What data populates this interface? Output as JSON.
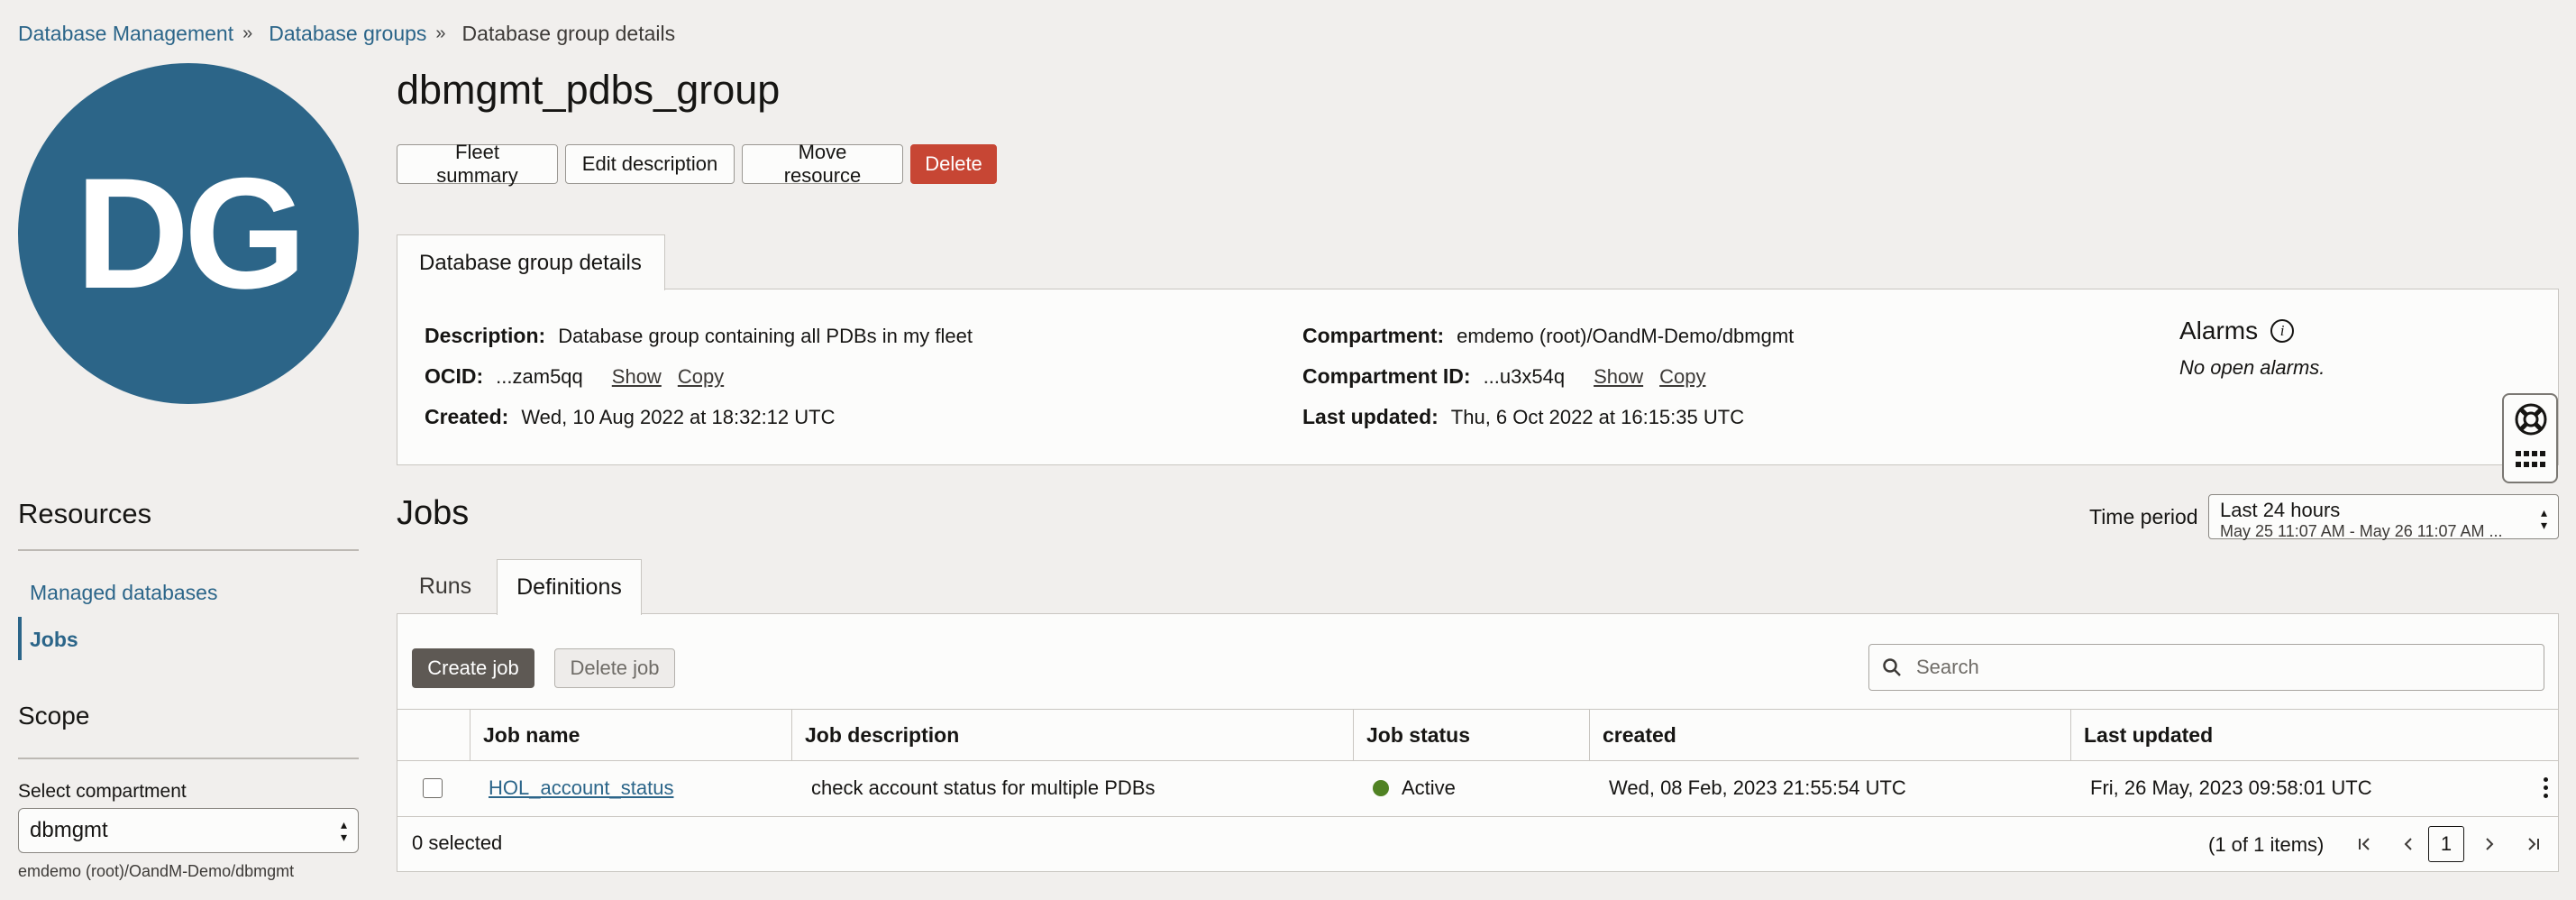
{
  "breadcrumb": {
    "items": [
      "Database Management",
      "Database groups"
    ],
    "current": "Database group details"
  },
  "avatar": {
    "initials": "DG",
    "color": "#2c6588"
  },
  "page": {
    "title": "dbmgmt_pdbs_group"
  },
  "actions": {
    "fleet_summary": "Fleet summary",
    "edit_description": "Edit description",
    "move_resource": "Move resource",
    "delete": "Delete"
  },
  "details": {
    "tab_label": "Database group details",
    "description_label": "Description:",
    "description_value": "Database group containing all PDBs in my fleet",
    "ocid_label": "OCID:",
    "ocid_value": "...zam5qq",
    "show": "Show",
    "copy": "Copy",
    "created_label": "Created:",
    "created_value": "Wed, 10 Aug 2022 at 18:32:12 UTC",
    "compartment_label": "Compartment:",
    "compartment_value": "emdemo (root)/OandM-Demo/dbmgmt",
    "compartment_id_label": "Compartment ID:",
    "compartment_id_value": "...u3x54q",
    "last_updated_label": "Last updated:",
    "last_updated_value": "Thu, 6 Oct 2022 at 16:15:35 UTC",
    "alarms_title": "Alarms",
    "alarms_info_icon": "i",
    "alarms_note": "No open alarms."
  },
  "sidebar": {
    "resources_heading": "Resources",
    "items": [
      {
        "label": "Managed databases",
        "active": false
      },
      {
        "label": "Jobs",
        "active": true
      }
    ],
    "scope_heading": "Scope",
    "select_compartment_label": "Select compartment",
    "compartment_selected": "dbmgmt",
    "compartment_path": "emdemo (root)/OandM-Demo/dbmgmt"
  },
  "jobs": {
    "title": "Jobs",
    "time_period_label": "Time period",
    "time_period_value": "Last 24 hours",
    "time_period_range": "May 25 11:07 AM - May 26 11:07 AM ...",
    "tabs": [
      {
        "label": "Runs",
        "active": false
      },
      {
        "label": "Definitions",
        "active": true
      }
    ],
    "create_job": "Create job",
    "delete_job": "Delete job",
    "search_placeholder": "Search",
    "columns": [
      "Job name",
      "Job description",
      "Job status",
      "created",
      "Last updated"
    ],
    "rows": [
      {
        "name": "HOL_account_status",
        "description": "check account status for multiple PDBs",
        "status": "Active",
        "status_color": "#508223",
        "created": "Wed, 08 Feb, 2023 21:55:54 UTC",
        "last_updated": "Fri, 26 May, 2023 09:58:01 UTC"
      }
    ],
    "selected_text": "0 selected",
    "pagination_text": "(1 of 1 items)",
    "current_page": "1"
  },
  "icons": {
    "help": "lifebuoy-icon",
    "apps": "grid-icon",
    "search": "search-icon"
  }
}
